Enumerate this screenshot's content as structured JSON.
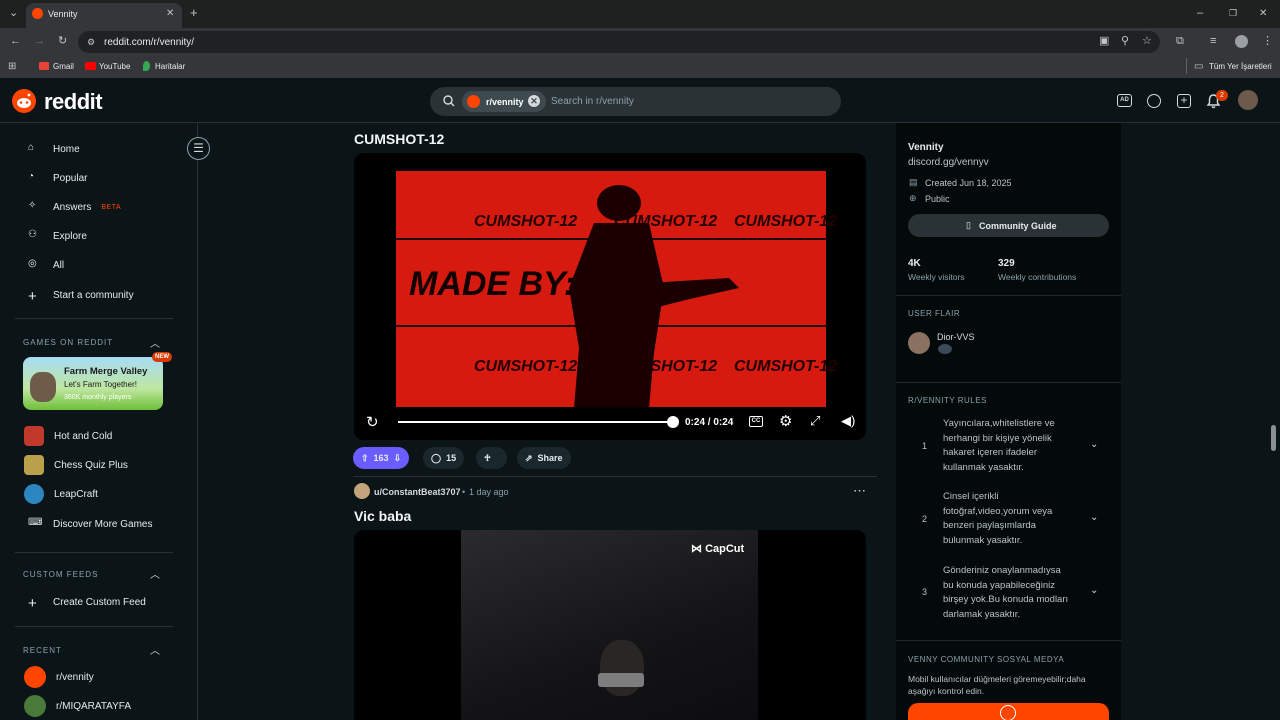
{
  "browser": {
    "tab_title": "Vennity",
    "url": "reddit.com/r/vennity/",
    "bookmarks": [
      "Gmail",
      "YouTube",
      "Haritalar"
    ],
    "all_bookmarks": "Tüm Yer İşaretleri",
    "new_tab": "+"
  },
  "header": {
    "logo": "reddit",
    "search_chip": "r/vennity",
    "search_placeholder": "Search in r/vennity",
    "notif_count": "2"
  },
  "sidebar": {
    "nav": [
      "Home",
      "Popular",
      "Answers",
      "Explore",
      "All",
      "Start a community"
    ],
    "answers_badge": "BETA",
    "games_heading": "GAMES ON REDDIT",
    "featured_game": {
      "title": "Farm Merge Valley",
      "subtitle": "Let's Farm Together!",
      "players": "360K monthly players",
      "badge": "NEW"
    },
    "games": [
      "Hot and Cold",
      "Chess Quiz Plus",
      "LeapCraft",
      "Discover More Games"
    ],
    "custom_feeds_heading": "CUSTOM FEEDS",
    "create_feed": "Create Custom Feed",
    "recent_heading": "RECENT",
    "recent": [
      "r/vennity",
      "r/MIQARATAYFA"
    ]
  },
  "post1": {
    "title": "CUMSHOT-12",
    "video_texts": [
      "CUMSHOT-12",
      "CUMSHOT-12",
      "CUMSHOT-12",
      "MADE BY: R",
      "CUMSHOT-12",
      "CUMSHOT-12",
      "CUMSHOT-12"
    ],
    "time": "0:24 / 0:24",
    "progress": 1.0,
    "votes": "163",
    "comments": "15",
    "share": "Share"
  },
  "post2": {
    "author": "u/ConstantBeat3707",
    "age": "1 day ago",
    "title": "Vic baba",
    "watermark": "CapCut"
  },
  "community": {
    "name": "Vennity",
    "description": "discord.gg/vennyv",
    "created": "Created Jun 18, 2025",
    "visibility": "Public",
    "guide_button": "Community Guide",
    "weekly_visitors": "4K",
    "weekly_visitors_label": "Weekly visitors",
    "weekly_contributions": "329",
    "weekly_contributions_label": "Weekly contributions",
    "user_flair_heading": "USER FLAIR",
    "flair_user": "Dior-VVS",
    "rules_heading": "R/VENNITY RULES",
    "rules": [
      {
        "num": "1",
        "text": "Yayıncılara,whitelistlere ve herhangi bir kişiye yönelik hakaret içeren ifadeler kullanmak yasaktır."
      },
      {
        "num": "2",
        "text": "Cinsel içerikli fotoğraf,video,yorum veya benzeri paylaşımlarda bulunmak yasaktır."
      },
      {
        "num": "3",
        "text": "Gönderiniz onaylanmadıysa bu konuda yapabileceğiniz birşey yok.Bu konuda modları darlamak yasaktır."
      }
    ],
    "social_heading": "VENNY COMMUNITY SOSYAL MEDYA",
    "social_note": "Mobil kullanıcılar düğmeleri göremeyebilir;daha aşağıyı kontrol edin."
  },
  "colors": {
    "accent": "#ff4500",
    "upvote": "#6a5cff",
    "video_red": "#d61a10"
  }
}
